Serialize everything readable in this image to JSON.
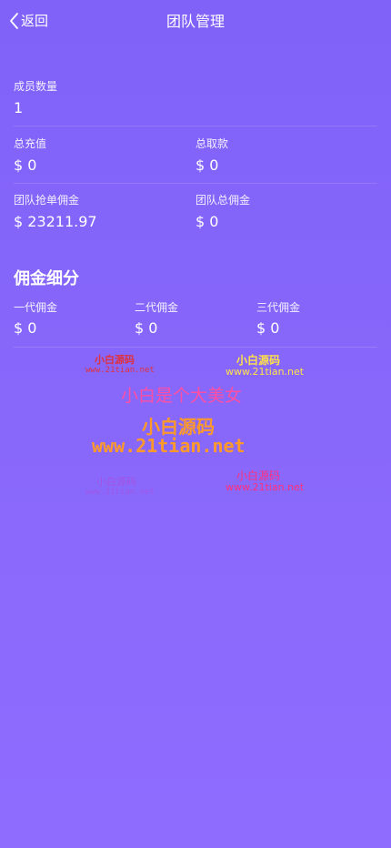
{
  "header": {
    "back_label": "返回",
    "title": "团队管理"
  },
  "member_count": {
    "label": "成员数量",
    "value": "1"
  },
  "totals": {
    "recharge_label": "总充值",
    "recharge_value": "$ 0",
    "withdraw_label": "总取款",
    "withdraw_value": "$ 0",
    "grab_commission_label": "团队抢单佣金",
    "grab_commission_value": "$ 23211.97",
    "total_commission_label": "团队总佣金",
    "total_commission_value": "$ 0"
  },
  "commission_breakdown": {
    "title": "佣金细分",
    "items": [
      {
        "label": "一代佣金",
        "value": "$ 0"
      },
      {
        "label": "二代佣金",
        "value": "$ 0"
      },
      {
        "label": "三代佣金",
        "value": "$ 0"
      }
    ]
  },
  "watermarks": {
    "site_name": "小白源码",
    "site_url": "www.21tian.net",
    "slogan": "小白是个大美女",
    "big_url": "www.21tian.net"
  },
  "colors": {
    "background_top": "#8062f9",
    "background_bottom": "#8f6cfe"
  }
}
